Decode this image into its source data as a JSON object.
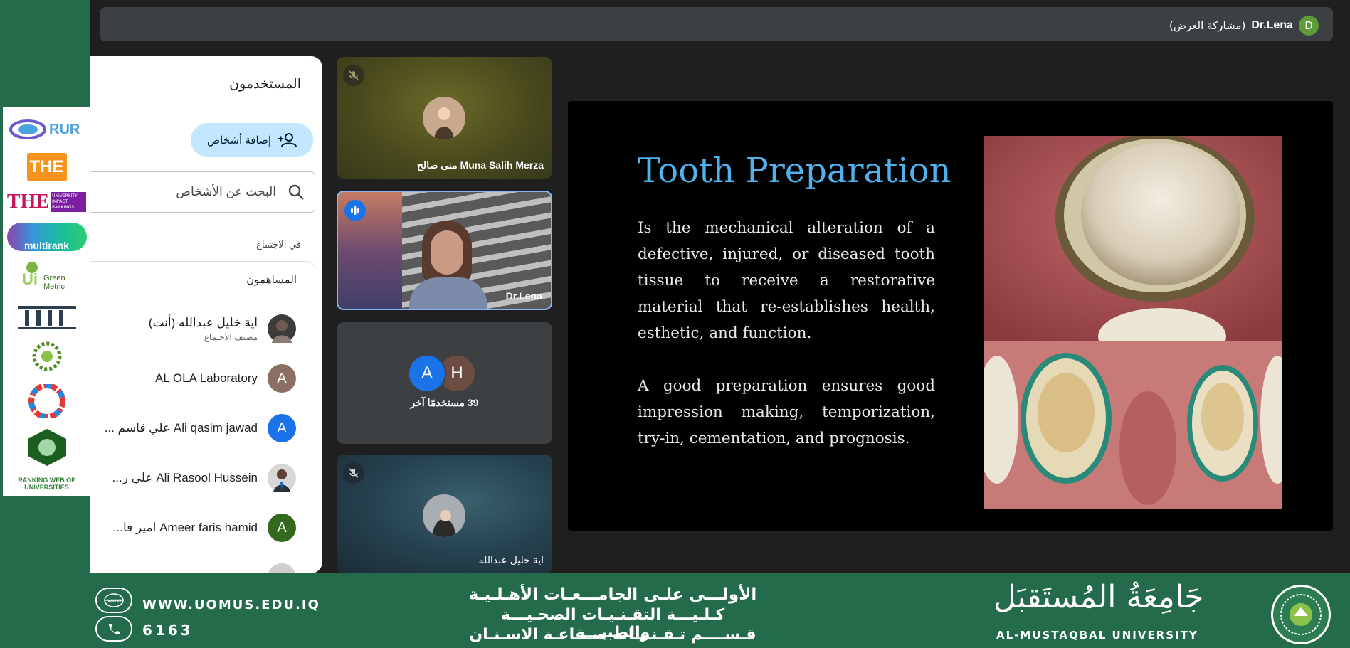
{
  "presenter": {
    "initial": "D",
    "name": "Dr.Lena",
    "status": "(مشاركة العرض)"
  },
  "people_panel": {
    "title": "المستخدمون",
    "add_people": "إضافة أشخاص",
    "search_placeholder": "البحث عن الأشخاص",
    "in_meeting": "في الاجتماع",
    "contributors": "المساهمون",
    "participants": [
      {
        "name": "اية خليل عبدالله (أنت)",
        "role": "مضيف الاجتماع",
        "initial": "",
        "color": "#3c3c3c"
      },
      {
        "name": "AL OLA Laboratory",
        "role": "",
        "initial": "A",
        "color": "#8d6e63"
      },
      {
        "name": "Ali qasim jawad علي قاسم ...",
        "role": "",
        "initial": "A",
        "color": "#1a73e8"
      },
      {
        "name": "Ali Rasool Hussein علي ر...",
        "role": "",
        "initial": "",
        "color": "#d7d7d7"
      },
      {
        "name": "Ameer faris hamid امير فا...",
        "role": "",
        "initial": "A",
        "color": "#33691e"
      }
    ]
  },
  "tiles": {
    "muna": {
      "label": "Muna Salih Merza منى صالح"
    },
    "lena": {
      "label": "Dr.Lena"
    },
    "others": {
      "label": "39 مستخدمًا آخر",
      "initial_a": "A",
      "initial_h": "H"
    },
    "aya": {
      "label": "اية خليل عبدالله"
    }
  },
  "slide": {
    "title": "Tooth Preparation",
    "paragraph1": "Is the mechanical alteration of a defective, injured, or diseased tooth tissue to receive a restorative material that re-establishes health, esthetic, and function.",
    "paragraph2": "A good preparation ensures good impression making, temporization, try-in, cementation, and prognosis."
  },
  "logos": {
    "rur": "RUR",
    "the": "THE",
    "the_impact": "THE",
    "the_impact_sub": "UNIVERSITY IMPACT RANKINGS",
    "multirank": "multirank",
    "greenmetric": "UI Green Metric",
    "rwu": "RANKING WEB OF UNIVERSITIES"
  },
  "footer": {
    "website": "WWW.UOMUS.EDU.IQ",
    "phone": "6163",
    "line1": "الأولـــى علـى الجامـــعـات الأهـلـيـة",
    "line2": "كـلـيـــة التقـنـيـات الصحـيـــة والطبيـــة",
    "line3": "قـســــم تـقـنـيـات صـنـاعـة الاسـنـان",
    "uni_ar": "جَامِعَةُ المُستَقبَل",
    "uni_en": "AL-MUSTAQBAL UNIVERSITY"
  },
  "colors": {
    "accent": "#4fb2ec",
    "brand_green": "#236b4b",
    "button_blue": "#c2e7ff"
  }
}
